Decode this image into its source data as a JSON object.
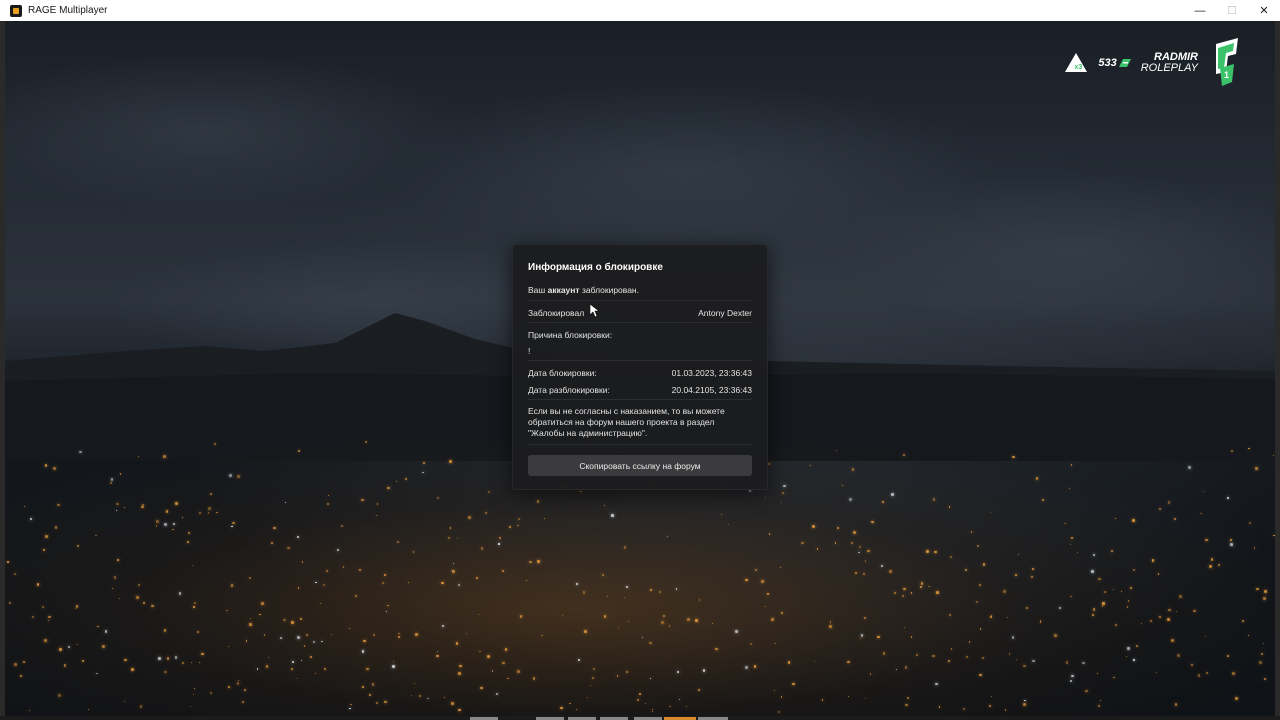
{
  "window": {
    "title": "RAGE Multiplayer",
    "controls": {
      "minimize": "—",
      "maximize": "☐",
      "close": "✕"
    }
  },
  "hud": {
    "bonus_multiplier": "x3",
    "online_count": "533",
    "brand_line1": "RADMIR",
    "brand_line2": "ROLEPLAY",
    "server_number": "1",
    "accent_color": "#3cc26a"
  },
  "dialog": {
    "title": "Информация о блокировке",
    "account_prefix": "Ваш",
    "account_bold": "аккаунт",
    "account_suffix": "заблокирован.",
    "blocked_by_label": "Заблокировал",
    "blocked_by_value": "Antony Dexter",
    "reason_label": "Причина блокировки:",
    "reason_value": "!",
    "block_date_label": "Дата блокировки:",
    "block_date_value": "01.03.2023, 23:36:43",
    "unblock_date_label": "Дата разблокировки:",
    "unblock_date_value": "20.04.2105, 23:36:43",
    "notice_line1": "Если вы не согласны с наказанием, то вы можете",
    "notice_line2": "обратиться на форум нашего проекта в раздел",
    "notice_line3": "\"Жалобы на администрацию\".",
    "copy_button": "Скопировать ссылку на форум"
  },
  "icons": {
    "app": "rage-mp-icon",
    "online": "online-users-icon",
    "logo": "radmir-logo-icon",
    "cursor": "mouse-cursor-icon"
  }
}
